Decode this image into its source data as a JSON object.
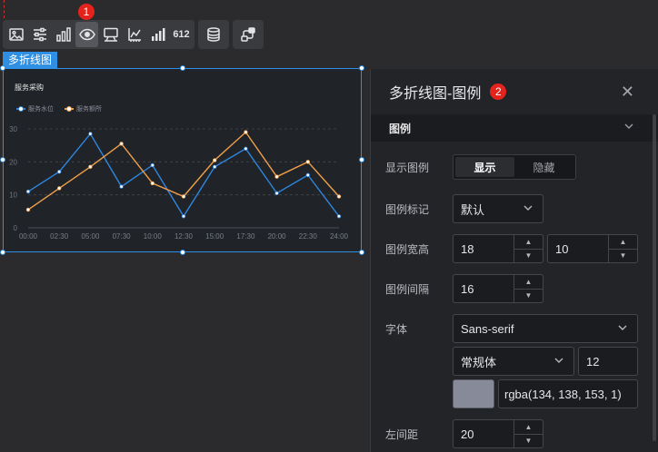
{
  "markers": {
    "one": "1",
    "two": "2"
  },
  "toolbar": {
    "buttons": [
      "image-icon",
      "sliders-icon",
      "bar-chart-icon",
      "eye-target-icon",
      "comment-chart-icon",
      "axis-icon",
      "signal-chart-icon",
      "number-icon"
    ],
    "number_label": "612",
    "extra": [
      "database-icon",
      "share-data-icon"
    ]
  },
  "component": {
    "tag": "多折线图"
  },
  "chart_data": {
    "type": "line",
    "title": "服务采购",
    "categories": [
      "00:00",
      "02:30",
      "05:00",
      "07:30",
      "10:00",
      "12:30",
      "15:00",
      "17:30",
      "20:00",
      "22:30",
      "24:00"
    ],
    "series": [
      {
        "name": "服务水位",
        "color": "#2e86de",
        "values": [
          11,
          17,
          28.5,
          12.5,
          19,
          3.5,
          18.5,
          24,
          10.5,
          16,
          3.5
        ]
      },
      {
        "name": "服务额所",
        "color": "#f0a04b",
        "values": [
          5.5,
          12,
          18.5,
          25.5,
          13.5,
          9.5,
          20.5,
          29,
          15.5,
          20,
          9.5
        ]
      }
    ],
    "ylim": [
      0,
      30
    ],
    "yticks": [
      "0",
      "10",
      "20",
      "30"
    ],
    "grid": true,
    "legend": "top-left"
  },
  "panel": {
    "title": "多折线图-图例",
    "close": "✕",
    "section": "图例",
    "show_legend": {
      "label": "显示图例",
      "on": "显示",
      "off": "隐藏"
    },
    "legend_mark": {
      "label": "图例标记",
      "value": "默认"
    },
    "legend_size": {
      "label": "图例宽高",
      "width": "18",
      "height": "10"
    },
    "legend_gap": {
      "label": "图例间隔",
      "value": "16"
    },
    "font": {
      "label": "字体",
      "family": "Sans-serif",
      "style": "常规体",
      "size": "12",
      "color": "rgba(134, 138, 153, 1)"
    },
    "left_margin": {
      "label": "左间距",
      "value": "20"
    }
  }
}
